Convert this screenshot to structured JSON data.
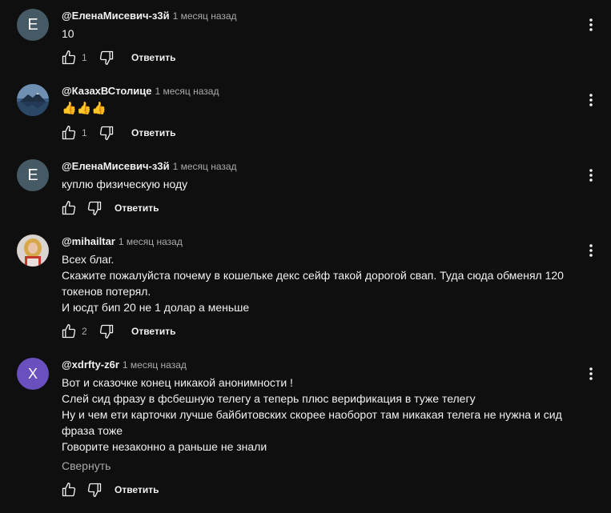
{
  "comments": [
    {
      "author": "@ЕленаМисевич-з3й",
      "time": "1 месяц назад",
      "avatar_letter": "Е",
      "text_lines": [
        "10"
      ],
      "likes": "1",
      "reply_label": "Ответить"
    },
    {
      "author": "@КазахВСтолице",
      "time": "1 месяц назад",
      "avatar_image": "mountain-lake-avatar",
      "text_lines": [
        "👍👍👍"
      ],
      "likes": "1",
      "reply_label": "Ответить"
    },
    {
      "author": "@ЕленаМисевич-з3й",
      "time": "1 месяц назад",
      "avatar_letter": "Е",
      "text_lines": [
        "куплю физическую ноду"
      ],
      "likes": "",
      "reply_label": "Ответить"
    },
    {
      "author": "@mihailtar",
      "time": "1 месяц назад",
      "avatar_image": "person-photo-avatar",
      "text_lines": [
        "Всех благ.",
        "Скажите пожалуйста почему в кошельке  декс сейф такой дорогой свап. Туда сюда обменял 120",
        "токенов потерял.",
        "И юсдт бип 20 не 1 долар а меньше"
      ],
      "likes": "2",
      "reply_label": "Ответить"
    },
    {
      "author": "@xdrfty-z6r",
      "time": "1 месяц назад",
      "avatar_letter": "X",
      "text_lines": [
        "Вот и сказочке конец никакой анонимности !",
        "Слей сид фразу в фсбешную телегу а теперь плюс верификация в туже телегу",
        "Ну и чем ети карточки лучше байбитовских скорее наоборот там никакая телега не нужна и сид",
        "фраза тоже",
        "Говорите незаконно а раньше не знали"
      ],
      "collapse_label": "Свернуть",
      "likes": "",
      "reply_label": "Ответить"
    }
  ],
  "colors": {
    "background": "#0f0f0f",
    "text": "#f1f1f1",
    "secondary_text": "#aaaaaa",
    "avatar_gray": "#455a64",
    "avatar_purple": "#6a4fbf"
  },
  "icons": [
    "thumb-up-icon",
    "thumb-down-icon",
    "more-vert-icon"
  ]
}
